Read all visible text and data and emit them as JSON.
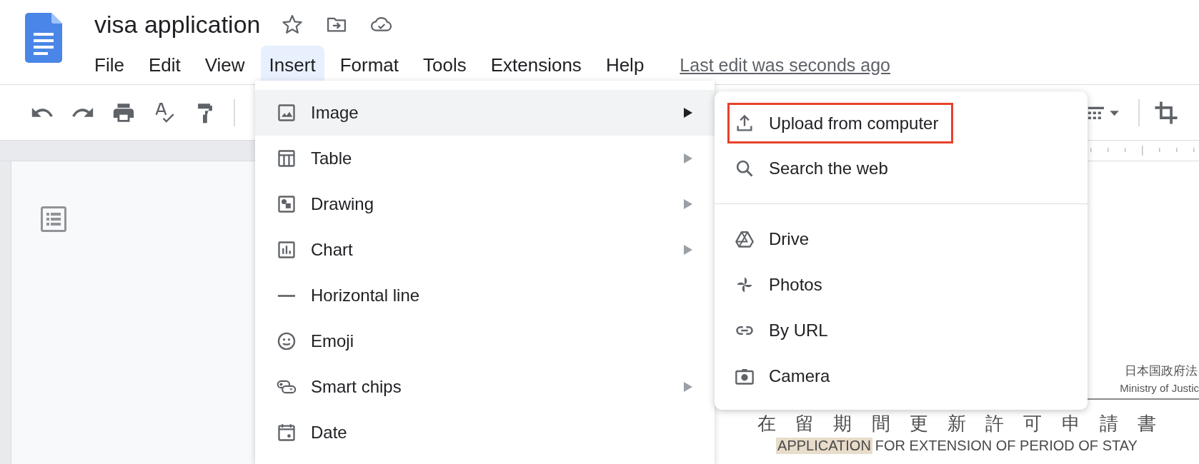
{
  "document": {
    "title": "visa application"
  },
  "menu_bar": {
    "items": [
      {
        "label": "File",
        "selected": false
      },
      {
        "label": "Edit",
        "selected": false
      },
      {
        "label": "View",
        "selected": false
      },
      {
        "label": "Insert",
        "selected": true
      },
      {
        "label": "Format",
        "selected": false
      },
      {
        "label": "Tools",
        "selected": false
      },
      {
        "label": "Extensions",
        "selected": false
      },
      {
        "label": "Help",
        "selected": false
      }
    ],
    "last_edit": "Last edit was seconds ago"
  },
  "insert_menu": {
    "items": [
      {
        "kind": "image",
        "label": "Image",
        "selected": true,
        "has_submenu": true
      },
      {
        "kind": "table",
        "label": "Table",
        "selected": false,
        "has_submenu": true
      },
      {
        "kind": "drawing",
        "label": "Drawing",
        "selected": false,
        "has_submenu": true
      },
      {
        "kind": "chart",
        "label": "Chart",
        "selected": false,
        "has_submenu": true
      },
      {
        "kind": "line",
        "label": "Horizontal line",
        "selected": false,
        "has_submenu": false
      },
      {
        "kind": "emoji",
        "label": "Emoji",
        "selected": false,
        "has_submenu": false
      },
      {
        "kind": "chips",
        "label": "Smart chips",
        "selected": false,
        "has_submenu": true
      },
      {
        "kind": "date",
        "label": "Date",
        "selected": false,
        "has_submenu": false
      }
    ]
  },
  "image_submenu": {
    "sections": [
      {
        "items": [
          {
            "kind": "upload",
            "label": "Upload from computer",
            "highlighted": true
          },
          {
            "kind": "search",
            "label": "Search the web",
            "highlighted": false
          }
        ]
      },
      {
        "items": [
          {
            "kind": "drive",
            "label": "Drive",
            "highlighted": false
          },
          {
            "kind": "photos",
            "label": "Photos",
            "highlighted": false
          },
          {
            "kind": "url",
            "label": "By URL",
            "highlighted": false
          },
          {
            "kind": "camera",
            "label": "Camera",
            "highlighted": false
          }
        ]
      }
    ]
  },
  "page": {
    "header_ja": "日本国政府法",
    "header_en": "Ministry of Justic",
    "title_ja": "在 留 期 間 更 新 許 可 申 請 書",
    "title_en_highlighted": "APPLICATION",
    "title_en_rest": "FOR EXTENSION OF PERIOD OF STAY"
  }
}
